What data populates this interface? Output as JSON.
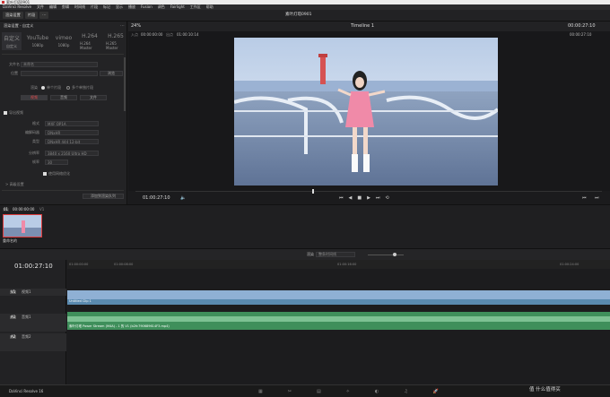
{
  "titlebar": {
    "title": "索叶灯塔0901"
  },
  "menubar": {
    "items": [
      "DaVinci Resolve",
      "文件",
      "编辑",
      "剪辑",
      "时间线",
      "片段",
      "标记",
      "显示",
      "播放",
      "Fusion",
      "调色",
      "Fairlight",
      "工作区",
      "帮助"
    ]
  },
  "toolbar": {
    "render_settings": "渲染设置",
    "clips": "片段",
    "project_title": "素叶灯塔0901",
    "timeline_name": "Timeline 1",
    "zoom": "24%",
    "tc_right": "00:00:27:10"
  },
  "render": {
    "header": "渲染设置 - 自定义",
    "presets": [
      {
        "logo": "自定义",
        "label": "自定义"
      },
      {
        "logo": "YouTube",
        "label": "1080p"
      },
      {
        "logo": "vimeo",
        "label": "1080p"
      },
      {
        "logo": "H.264",
        "label": "H.264 Master"
      },
      {
        "logo": "H.265",
        "label": "H.265 Master"
      }
    ],
    "filename_label": "文件名",
    "filename_value": "未命名",
    "location_label": "位置",
    "browse": "浏览",
    "render_label": "渲染",
    "mode_single": "单个片段",
    "mode_multi": "多个单独片段",
    "tabs": [
      "视频",
      "音频",
      "文件"
    ],
    "export_video": "导出视频",
    "format_label": "格式",
    "format_value": "MXF OP1A",
    "codec_label": "编解码器",
    "codec_value": "DNxHR",
    "type_label": "类型",
    "type_value": "DNxHR 444 12-bit",
    "resolution_label": "分辨率",
    "resolution_value": "3840 x 2160 Ultra HD",
    "fps_label": "帧率",
    "fps_value": "30",
    "checkbox_network": "使用网络优化",
    "advanced": "> 高级设置",
    "add_queue": "添加到渲染队列"
  },
  "viewer": {
    "tc_left": "00:00:00:00",
    "tc_in": "01:00:10:14",
    "tc_out_label": "00:00:27:10",
    "current_tc": "01:00:27:10"
  },
  "bin": {
    "clip_tc": "00:00:00:00",
    "clip_track": "V1",
    "clip_name": "重命名的"
  },
  "timeline": {
    "current_tc": "01:00:27:10",
    "ruler": [
      "01:00:00:00",
      "01:00:08:00",
      "01:00:16:00",
      "01:00:24:00"
    ],
    "tracks": [
      {
        "id": "V1",
        "name": "视频1"
      },
      {
        "id": "A1",
        "name": "音频1"
      },
      {
        "id": "A2",
        "name": "音频2"
      }
    ],
    "video_clip": "Untitled Clip 1",
    "audio_clip": "索叶灯塔 Power Stream (M4A) - 1 的 V1 (b2fc790689614F3.mp4)",
    "toolbar_labels": [
      "渲染",
      "整条时间线"
    ]
  },
  "bottombar": {
    "app": "DaVinci Resolve 16",
    "watermark": "值 什么值得买"
  },
  "colors": {
    "accent": "#e03c3c",
    "video_clip": "#5a8ab0",
    "audio_clip": "#3f8f5b"
  }
}
